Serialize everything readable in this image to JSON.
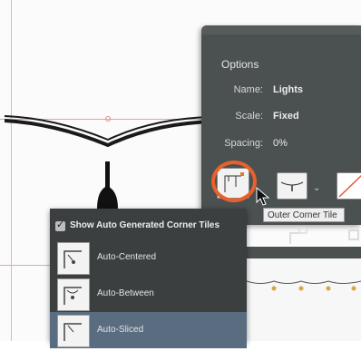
{
  "panel": {
    "title": "Options",
    "rows": [
      {
        "label": "Name:",
        "value": "Lights"
      },
      {
        "label": "Scale:",
        "value": "Fixed"
      },
      {
        "label": "Spacing:",
        "value": "0%"
      }
    ],
    "tooltip": "Outer Corner Tile"
  },
  "dropdown": {
    "header_label": "Show Auto Generated Corner Tiles",
    "header_checked": true,
    "items": [
      {
        "label": "Auto-Centered",
        "selected": false
      },
      {
        "label": "Auto-Between",
        "selected": false
      },
      {
        "label": "Auto-Sliced",
        "selected": true
      }
    ]
  },
  "colors": {
    "panel_bg": "#4b5051",
    "dropdown_bg": "#3b3f40",
    "selected_row": "#5a6c80",
    "highlight_ring": "#e8612c",
    "guide": "#e8a3a3"
  },
  "icons": [
    "outer-corner-tile-icon",
    "side-tile-icon",
    "none-tile-icon",
    "cursor-arrow-icon",
    "chevron-down-icon",
    "checkbox-icon"
  ]
}
